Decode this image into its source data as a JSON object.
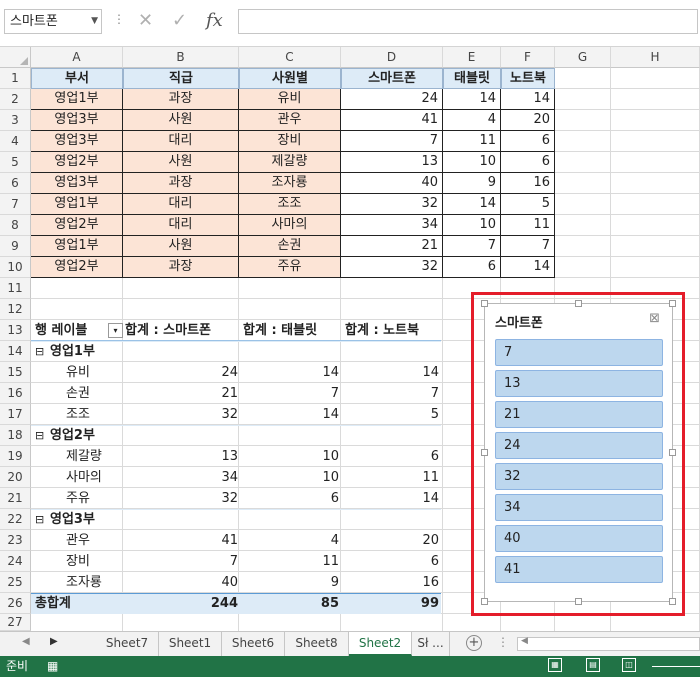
{
  "formula_bar": {
    "name_box": "스마트폰",
    "formula": ""
  },
  "columns": [
    "A",
    "B",
    "C",
    "D",
    "E",
    "F",
    "G",
    "H"
  ],
  "rows": [
    "1",
    "2",
    "3",
    "4",
    "5",
    "6",
    "7",
    "8",
    "9",
    "10",
    "11",
    "12",
    "13",
    "14",
    "15",
    "16",
    "17",
    "18",
    "19",
    "20",
    "21",
    "22",
    "23",
    "24",
    "25",
    "26",
    "27"
  ],
  "table": {
    "headers": [
      "부서",
      "직급",
      "사원별",
      "스마트폰",
      "태블릿",
      "노트북"
    ],
    "rows": [
      [
        "영업1부",
        "과장",
        "유비",
        "24",
        "14",
        "14"
      ],
      [
        "영업3부",
        "사원",
        "관우",
        "41",
        "4",
        "20"
      ],
      [
        "영업3부",
        "대리",
        "장비",
        "7",
        "11",
        "6"
      ],
      [
        "영업2부",
        "사원",
        "제갈량",
        "13",
        "10",
        "6"
      ],
      [
        "영업3부",
        "과장",
        "조자룡",
        "40",
        "9",
        "16"
      ],
      [
        "영업1부",
        "대리",
        "조조",
        "32",
        "14",
        "5"
      ],
      [
        "영업2부",
        "대리",
        "사마의",
        "34",
        "10",
        "11"
      ],
      [
        "영업1부",
        "사원",
        "손권",
        "21",
        "7",
        "7"
      ],
      [
        "영업2부",
        "과장",
        "주유",
        "32",
        "6",
        "14"
      ]
    ]
  },
  "pivot": {
    "row_label": "행 레이블",
    "headers": [
      "합계 : 스마트폰",
      "합계 : 태블릿",
      "합계 : 노트북"
    ],
    "groups": [
      {
        "name": "영업1부",
        "items": [
          [
            "유비",
            "24",
            "14",
            "14"
          ],
          [
            "손권",
            "21",
            "7",
            "7"
          ],
          [
            "조조",
            "32",
            "14",
            "5"
          ]
        ]
      },
      {
        "name": "영업2부",
        "items": [
          [
            "제갈량",
            "13",
            "10",
            "6"
          ],
          [
            "사마의",
            "34",
            "10",
            "11"
          ],
          [
            "주유",
            "32",
            "6",
            "14"
          ]
        ]
      },
      {
        "name": "영업3부",
        "items": [
          [
            "관우",
            "41",
            "4",
            "20"
          ],
          [
            "장비",
            "7",
            "11",
            "6"
          ],
          [
            "조자룡",
            "40",
            "9",
            "16"
          ]
        ]
      }
    ],
    "total_label": "총합계",
    "totals": [
      "244",
      "85",
      "99"
    ],
    "collapse_glyph": "⊟"
  },
  "slicer": {
    "title": "스마트폰",
    "items": [
      "7",
      "13",
      "21",
      "24",
      "32",
      "34",
      "40",
      "41"
    ]
  },
  "sheet_tabs": [
    "Sheet7",
    "Sheet1",
    "Sheet6",
    "Sheet8",
    "Sheet2",
    "Sł ..."
  ],
  "active_tab": "Sheet2",
  "status": {
    "ready": "준비"
  },
  "colors": {
    "header_fill": "#ddebf7",
    "cell_fill": "#fce4d6",
    "slicer_item": "#bdd7ee",
    "status_bar": "#217346",
    "highlight": "#e41d2a"
  }
}
